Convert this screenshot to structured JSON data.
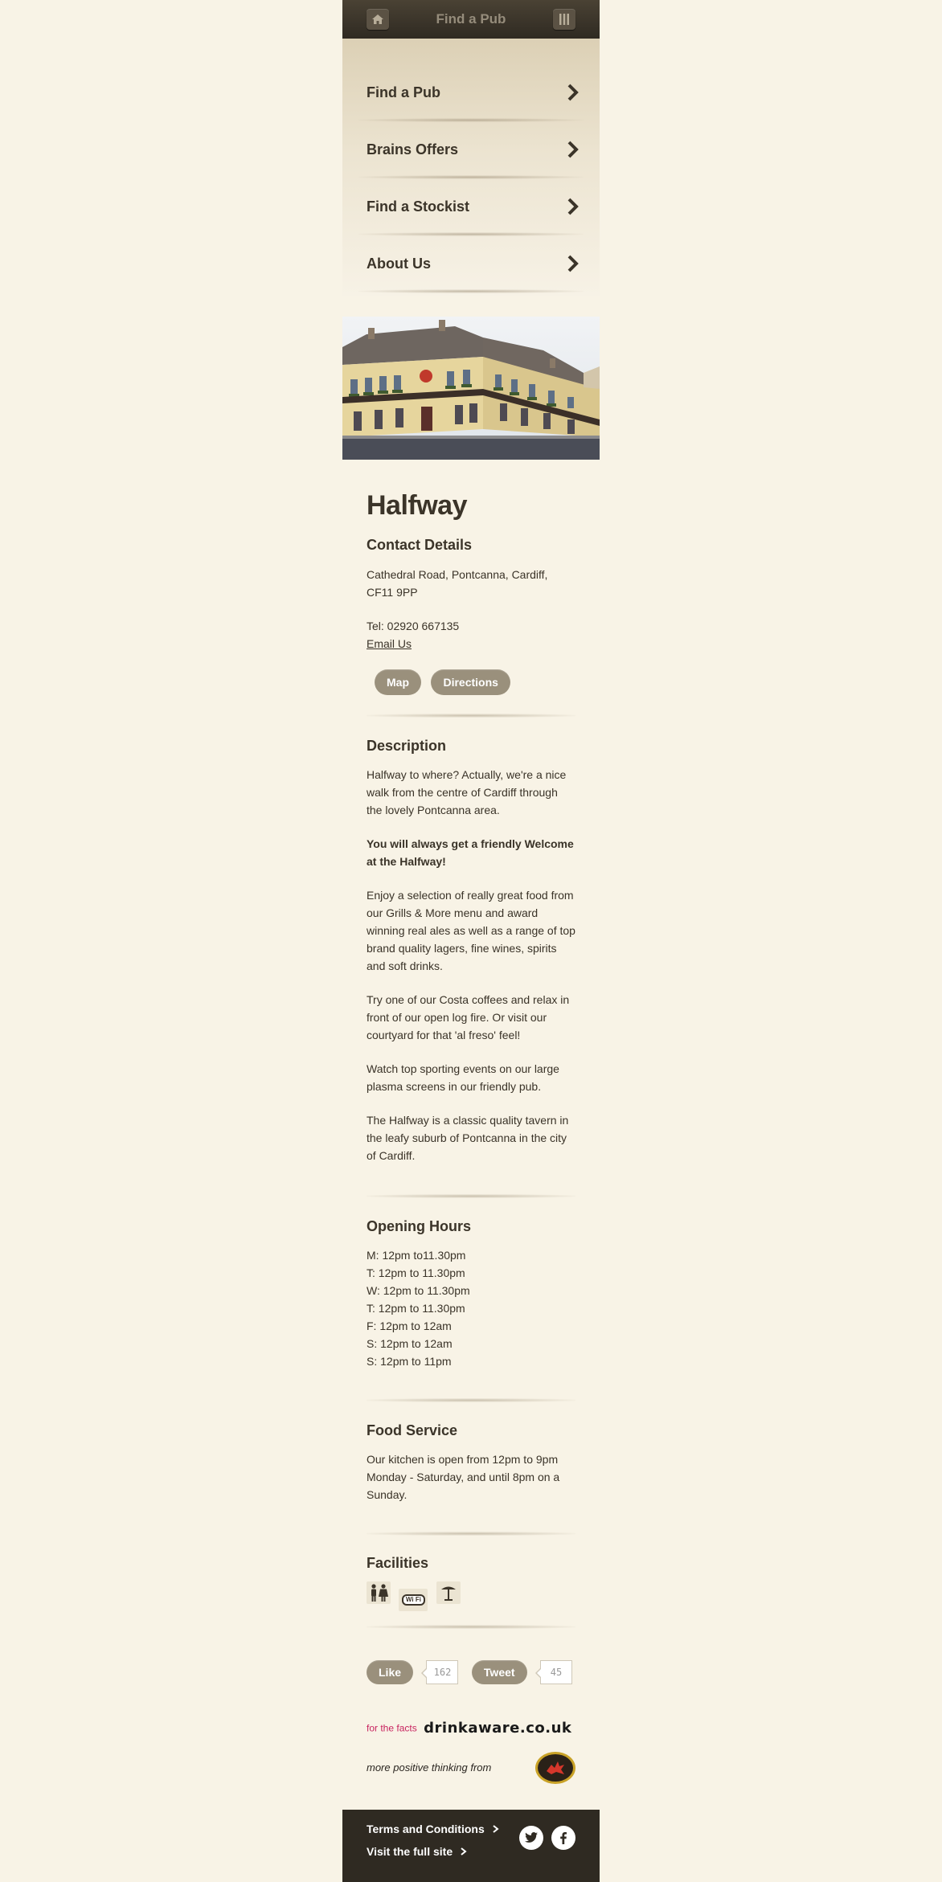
{
  "header": {
    "title": "Find a Pub"
  },
  "nav": {
    "items": [
      {
        "label": "Find a Pub"
      },
      {
        "label": "Brains Offers"
      },
      {
        "label": "Find a Stockist"
      },
      {
        "label": "About Us"
      }
    ]
  },
  "pub": {
    "name": "Halfway",
    "contact_heading": "Contact Details",
    "address_line1": "Cathedral Road, Pontcanna, Cardiff,",
    "address_line2": "CF11 9PP",
    "tel": "Tel: 02920 667135",
    "email_label": "Email Us",
    "map_label": "Map",
    "directions_label": "Directions"
  },
  "description": {
    "heading": "Description",
    "paragraphs": [
      "Halfway to where? Actually, we're a nice walk from the centre of Cardiff through the lovely Pontcanna area.",
      "You will always get a friendly Welcome at the Halfway!",
      "Enjoy a selection of really great food from our Grills & More menu and award winning real ales as well as a range of top brand quality lagers, fine wines, spirits and soft drinks.",
      "Try one of our Costa coffees and relax in front of our open log fire. Or visit our courtyard for that 'al freso' feel!",
      "Watch top sporting events on our large plasma screens in our friendly pub.",
      "The Halfway is a classic quality tavern in the leafy suburb of Pontcanna in the city of Cardiff."
    ]
  },
  "hours": {
    "heading": "Opening Hours",
    "lines": [
      "M: 12pm to11.30pm",
      "T: 12pm to 11.30pm",
      "W: 12pm to 11.30pm",
      "T: 12pm to 11.30pm",
      "F: 12pm to 12am",
      "S: 12pm to 12am",
      "S: 12pm to 11pm"
    ]
  },
  "food": {
    "heading": "Food Service",
    "text": "Our kitchen is open from 12pm to 9pm Monday - Saturday, and until 8pm on a Sunday."
  },
  "facilities": {
    "heading": "Facilities",
    "icons": [
      "family-friendly-icon",
      "wifi-icon",
      "beer-garden-icon"
    ],
    "wifi_text": "Wi Fi"
  },
  "social": {
    "like_label": "Like",
    "like_count": "162",
    "tweet_label": "Tweet",
    "tweet_count": "45"
  },
  "promo": {
    "for_the_facts": "for the facts",
    "drinkaware": "drinkaware.co.uk",
    "positive": "more positive thinking from",
    "brains_logo": "BRAINS"
  },
  "footer": {
    "terms": "Terms and Conditions",
    "full_site": "Visit the full site"
  },
  "colors": {
    "header_bg": "#2f2a22",
    "page_bg": "#f8f3e6",
    "pill_bg": "#9a907c",
    "text": "#3a3328",
    "drinkaware_pink": "#c8235f"
  }
}
